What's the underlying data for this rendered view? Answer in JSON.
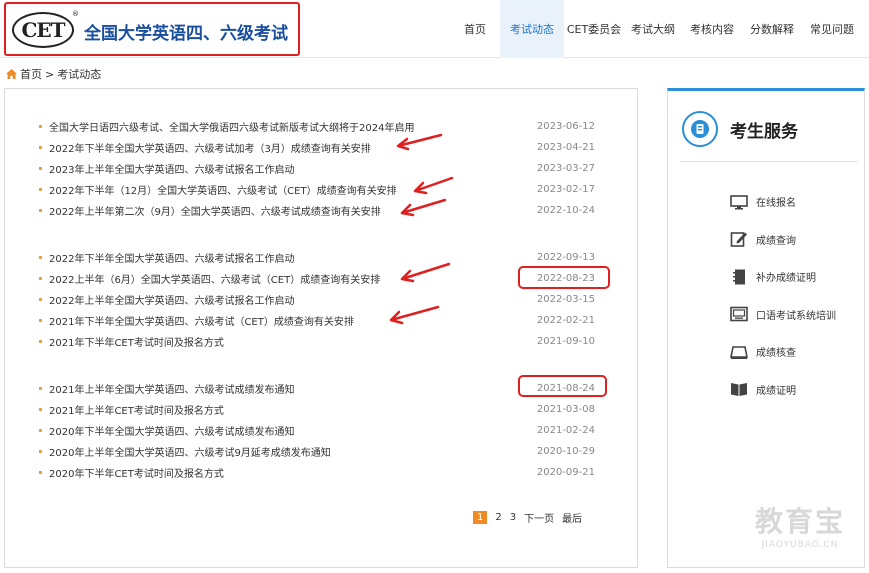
{
  "header": {
    "logo_text": "CET",
    "logo_reg": "®",
    "title": "全国大学英语四、六级考试"
  },
  "nav": [
    {
      "label": "首页",
      "active": false
    },
    {
      "label": "考试动态",
      "active": true
    },
    {
      "label": "CET委员会",
      "active": false
    },
    {
      "label": "考试大纲",
      "active": false
    },
    {
      "label": "考核内容",
      "active": false
    },
    {
      "label": "分数解释",
      "active": false
    },
    {
      "label": "常见问题",
      "active": false
    }
  ],
  "breadcrumb": {
    "home": "首页",
    "separator": ">",
    "current": "考试动态"
  },
  "news_groups": [
    [
      {
        "title": "全国大学日语四六级考试、全国大学俄语四六级考试新版考试大纲将于2024年启用",
        "date": "2023-06-12"
      },
      {
        "title": "2022年下半年全国大学英语四、六级考试加考（3月）成绩查询有关安排",
        "date": "2023-04-21"
      },
      {
        "title": "2023年上半年全国大学英语四、六级考试报名工作启动",
        "date": "2023-03-27"
      },
      {
        "title": "2022年下半年（12月）全国大学英语四、六级考试（CET）成绩查询有关安排",
        "date": "2023-02-17"
      },
      {
        "title": "2022年上半年第二次（9月）全国大学英语四、六级考试成绩查询有关安排",
        "date": "2022-10-24"
      }
    ],
    [
      {
        "title": "2022年下半年全国大学英语四、六级考试报名工作启动",
        "date": "2022-09-13"
      },
      {
        "title": "2022上半年（6月）全国大学英语四、六级考试（CET）成绩查询有关安排",
        "date": "2022-08-23"
      },
      {
        "title": "2022年上半年全国大学英语四、六级考试报名工作启动",
        "date": "2022-03-15"
      },
      {
        "title": "2021年下半年全国大学英语四、六级考试（CET）成绩查询有关安排",
        "date": "2022-02-21"
      },
      {
        "title": "2021年下半年CET考试时间及报名方式",
        "date": "2021-09-10"
      }
    ],
    [
      {
        "title": "2021年上半年全国大学英语四、六级考试成绩发布通知",
        "date": "2021-08-24"
      },
      {
        "title": "2021年上半年CET考试时间及报名方式",
        "date": "2021-03-08"
      },
      {
        "title": "2020年下半年全国大学英语四、六级考试成绩发布通知",
        "date": "2021-02-24"
      },
      {
        "title": "2020年上半年全国大学英语四、六级考试9月延考成绩发布通知",
        "date": "2020-10-29"
      },
      {
        "title": "2020年下半年CET考试时间及报名方式",
        "date": "2020-09-21"
      }
    ]
  ],
  "pagination": {
    "current": "1",
    "pages": [
      "2",
      "3"
    ],
    "next": "下一页",
    "last": "最后"
  },
  "side": {
    "title": "考生服务",
    "items": [
      {
        "label": "在线报名",
        "icon": "monitor-icon"
      },
      {
        "label": "成绩查询",
        "icon": "edit-icon"
      },
      {
        "label": "补办成绩证明",
        "icon": "notebook-icon"
      },
      {
        "label": "口语考试系统培训",
        "icon": "screen-icon"
      },
      {
        "label": "成绩核查",
        "icon": "tray-icon"
      },
      {
        "label": "成绩证明",
        "icon": "book-icon"
      }
    ]
  },
  "watermark": {
    "main": "教育宝",
    "sub": "JIAOYUBAO.CN"
  },
  "colors": {
    "accent": "#2b8fd8",
    "annotation": "#e02020",
    "active_nav": "#1a73c8",
    "pager_current": "#f08a24"
  }
}
